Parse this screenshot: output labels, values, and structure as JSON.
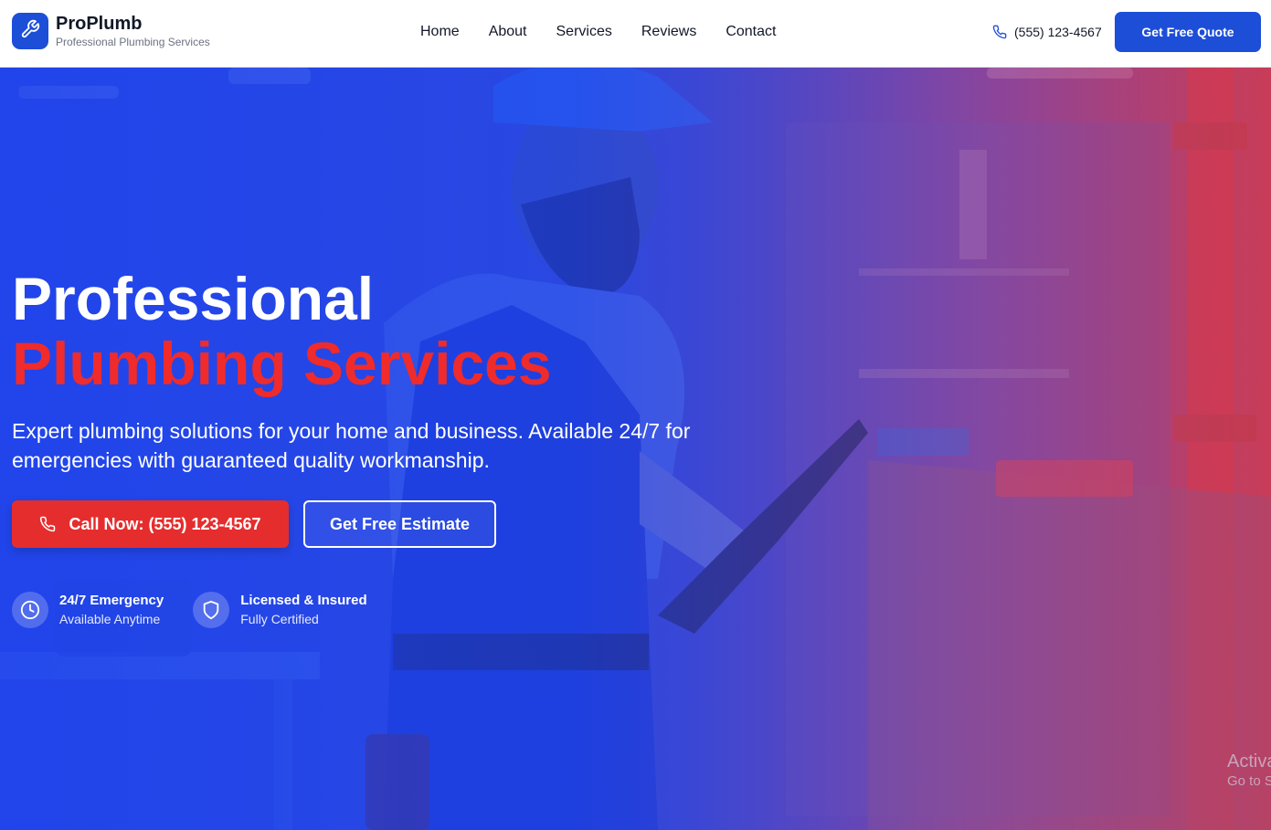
{
  "brand": {
    "name": "ProPlumb",
    "tagline": "Professional Plumbing Services",
    "logo_icon": "wrench-icon"
  },
  "nav": {
    "items": [
      {
        "label": "Home"
      },
      {
        "label": "About"
      },
      {
        "label": "Services"
      },
      {
        "label": "Reviews"
      },
      {
        "label": "Contact"
      }
    ]
  },
  "header": {
    "phone": "(555) 123-4567",
    "phone_icon": "phone-icon",
    "quote_button": "Get Free Quote"
  },
  "hero": {
    "title_line1": "Professional",
    "title_line2": "Plumbing Services",
    "description": "Expert plumbing solutions for your home and business. Available 24/7 for emergencies with guaranteed quality workmanship.",
    "call_button": "Call Now: (555) 123-4567",
    "estimate_button": "Get Free Estimate",
    "features": [
      {
        "title": "24/7 Emergency",
        "subtitle": "Available Anytime",
        "icon": "clock-icon"
      },
      {
        "title": "Licensed & Insured",
        "subtitle": "Fully Certified",
        "icon": "shield-icon"
      }
    ]
  },
  "watermark": {
    "line1": "Activa",
    "line2": "Go to S"
  },
  "colors": {
    "primary": "#1d4ed8",
    "accent_red": "#ef2b2b",
    "call_button": "#e52d2d",
    "text_dark": "#111827"
  }
}
